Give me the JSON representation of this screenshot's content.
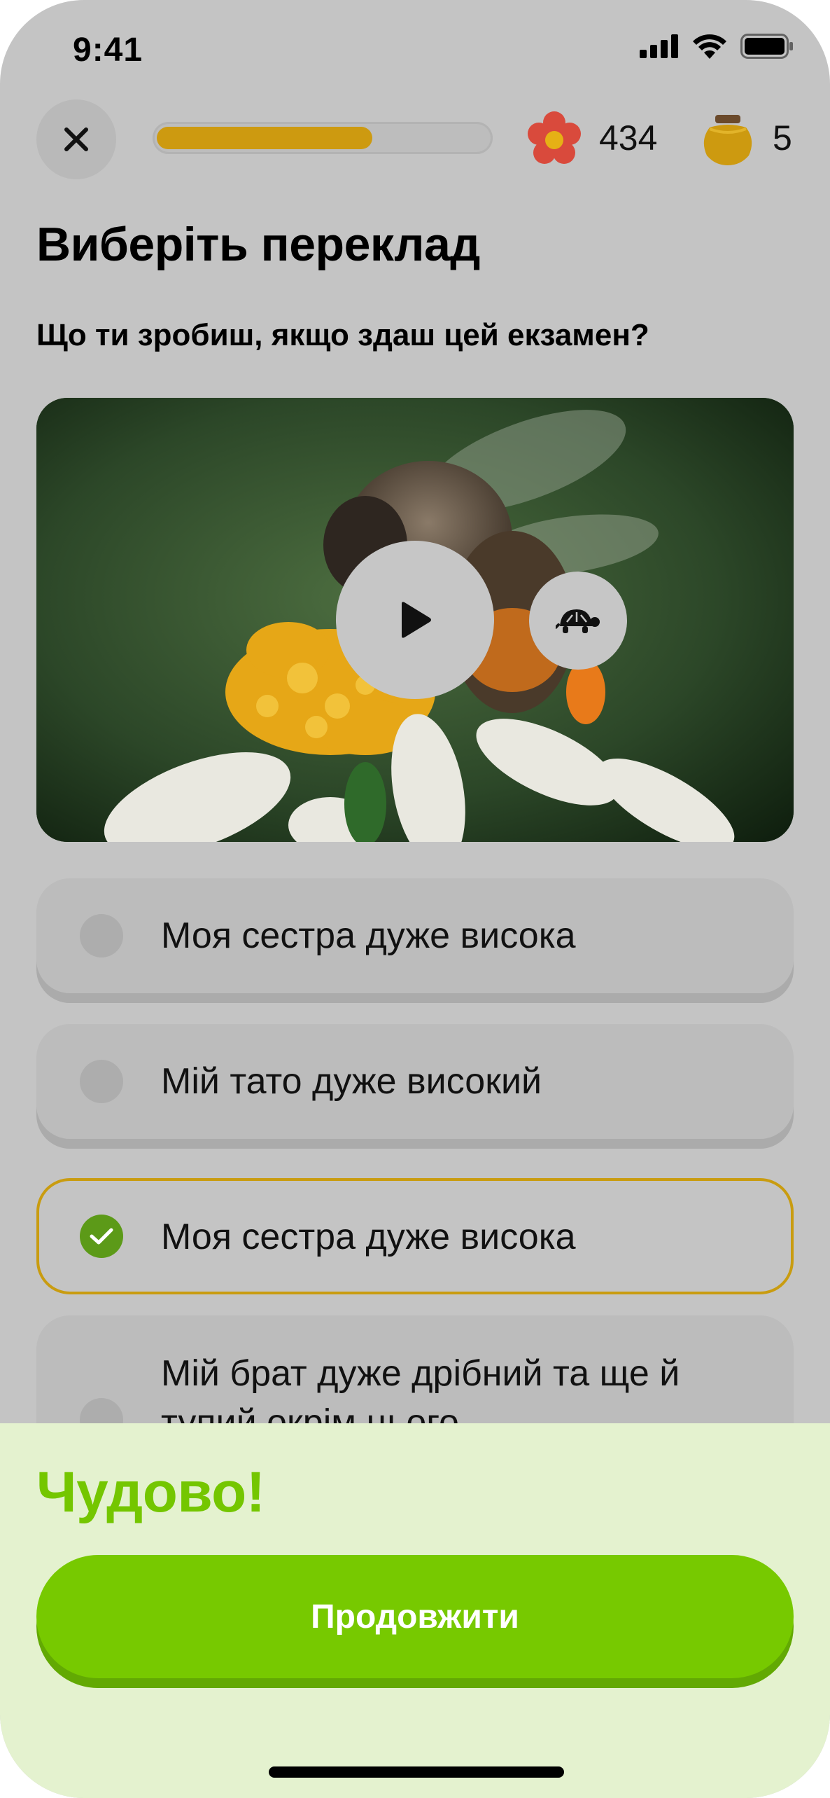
{
  "status_bar": {
    "time": "9:41"
  },
  "header": {
    "progress": 0.65,
    "flowers_count": "434",
    "honey_count": "5"
  },
  "exercise": {
    "title": "Виберіть переклад",
    "prompt": "Що ти зробиш, якщо здаш цей екзамен?"
  },
  "options": [
    {
      "label": "Моя сестра дуже висока",
      "selected": false
    },
    {
      "label": "Мій тато дуже високий",
      "selected": false
    },
    {
      "label": "Моя сестра дуже висока",
      "selected": true
    },
    {
      "label": "Мій брат дуже дрібний та ще й тупий окрім цього",
      "selected": false
    }
  ],
  "feedback": {
    "title": "Чудово!",
    "continue_label": "Продовжити"
  },
  "colors": {
    "accent_gold": "#cd9a10",
    "success_green": "#77c900",
    "sheet_bg": "#e4f2cf"
  },
  "icons": {
    "close": "close-icon",
    "flower": "flower-icon",
    "honey": "honey-pot-icon",
    "play": "play-icon",
    "slow": "turtle-icon",
    "check": "check-icon"
  }
}
